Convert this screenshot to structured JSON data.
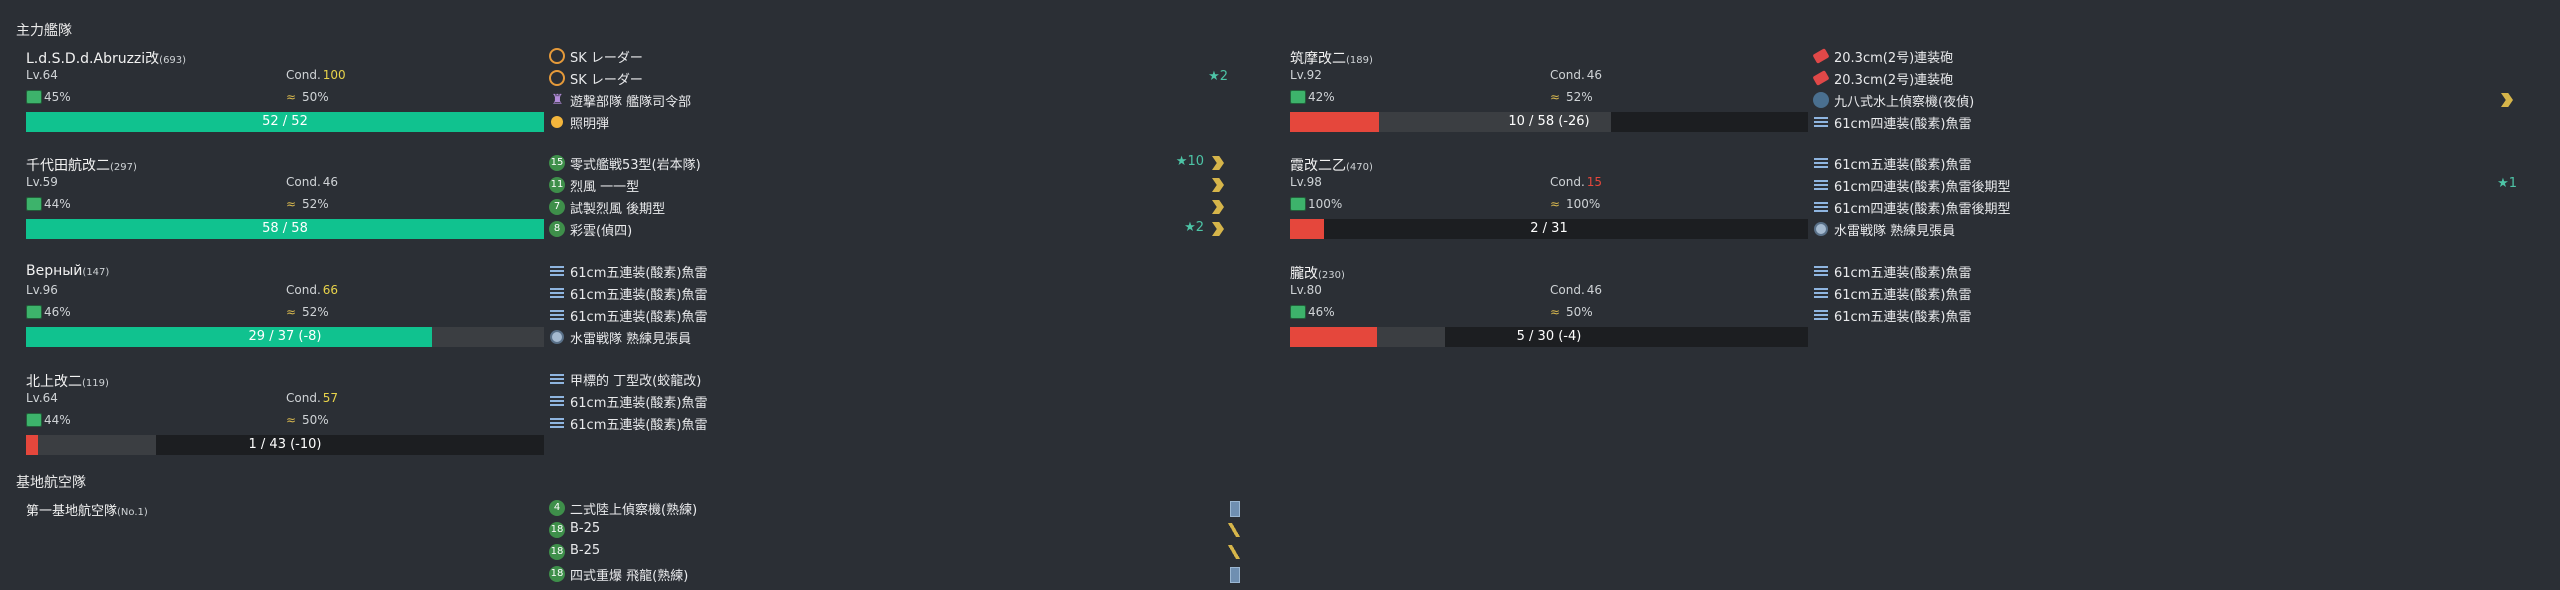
{
  "sections": {
    "fleet": "主力艦隊",
    "airbase": "基地航空隊"
  },
  "ships": [
    {
      "name": "L.d.S.D.d.Abruzzi改",
      "id": "(693)",
      "lv": "Lv.64",
      "cond_label": "Cond.",
      "cond": "100",
      "cond_color": "#e8d34a",
      "fuel": "45%",
      "ammo": "50%",
      "hp": "52 / 52",
      "hp_ratio": 1.0,
      "hp_color": "#10c28f",
      "track_ratio": 1.0,
      "equips": [
        {
          "icon": "radar-icon",
          "name": "SK レーダー",
          "star": "",
          "prof": ""
        },
        {
          "icon": "radar-icon",
          "name": "SK レーダー",
          "star": "★2",
          "prof": ""
        },
        {
          "icon": "command-icon",
          "name": "遊撃部隊 艦隊司令部",
          "star": "",
          "prof": ""
        },
        {
          "icon": "flare-icon",
          "name": "照明弾",
          "star": "",
          "prof": ""
        }
      ]
    },
    {
      "name": "筑摩改二",
      "id": "(189)",
      "lv": "Lv.92",
      "cond_label": "Cond.",
      "cond": "46",
      "cond_color": "#cfd3d6",
      "fuel": "42%",
      "ammo": "52%",
      "hp": "10 / 58 (-26)",
      "hp_ratio": 0.172,
      "hp_color": "#e5473c",
      "track_ratio": 0.62,
      "equips": [
        {
          "icon": "gun-icon",
          "name": "20.3cm(2号)連装砲",
          "star": "",
          "prof": ""
        },
        {
          "icon": "gun-icon",
          "name": "20.3cm(2号)連装砲",
          "star": "",
          "prof": ""
        },
        {
          "icon": "seaplane-icon",
          "name": "九八式水上偵察機(夜偵)",
          "star": "",
          "prof": "chevron"
        },
        {
          "icon": "torpedo-icon",
          "name": "61cm四連装(酸素)魚雷",
          "star": "",
          "prof": ""
        }
      ]
    },
    {
      "name": "千代田航改二",
      "id": "(297)",
      "lv": "Lv.59",
      "cond_label": "Cond.",
      "cond": "46",
      "cond_color": "#cfd3d6",
      "fuel": "44%",
      "ammo": "52%",
      "hp": "58 / 58",
      "hp_ratio": 1.0,
      "hp_color": "#10c28f",
      "track_ratio": 1.0,
      "equips": [
        {
          "icon": "plane-icon",
          "slot": "15",
          "name": "零式艦戦53型(岩本隊)",
          "star": "★10",
          "prof": "chevron"
        },
        {
          "icon": "plane-icon",
          "slot": "11",
          "name": "烈風 一一型",
          "star": "",
          "prof": "chevron"
        },
        {
          "icon": "plane-icon",
          "slot": "7",
          "name": "試製烈風 後期型",
          "star": "",
          "prof": "chevron"
        },
        {
          "icon": "plane-icon",
          "slot": "8",
          "name": "彩雲(偵四)",
          "star": "★2",
          "prof": "chevron"
        }
      ]
    },
    {
      "name": "霞改二乙",
      "id": "(470)",
      "lv": "Lv.98",
      "cond_label": "Cond.",
      "cond": "15",
      "cond_color": "#e5473c",
      "fuel": "100%",
      "ammo": "100%",
      "hp": "2 / 31",
      "hp_ratio": 0.065,
      "hp_color": "#e5473c",
      "track_ratio": 0.065,
      "equips": [
        {
          "icon": "torpedo-icon",
          "name": "61cm五連装(酸素)魚雷",
          "star": "",
          "prof": ""
        },
        {
          "icon": "torpedo-icon",
          "name": "61cm四連装(酸素)魚雷後期型",
          "star": "★1",
          "prof": ""
        },
        {
          "icon": "torpedo-icon",
          "name": "61cm四連装(酸素)魚雷後期型",
          "star": "",
          "prof": ""
        },
        {
          "icon": "sonar-icon",
          "name": "水雷戦隊 熟練見張員",
          "star": "",
          "prof": ""
        }
      ]
    },
    {
      "name": "Верный",
      "id": "(147)",
      "lv": "Lv.96",
      "cond_label": "Cond.",
      "cond": "66",
      "cond_color": "#e8d34a",
      "fuel": "46%",
      "ammo": "52%",
      "hp": "29 / 37 (-8)",
      "hp_ratio": 0.784,
      "hp_color": "#10c28f",
      "track_ratio": 1.0,
      "equips": [
        {
          "icon": "torpedo-icon",
          "name": "61cm五連装(酸素)魚雷",
          "star": "",
          "prof": ""
        },
        {
          "icon": "torpedo-icon",
          "name": "61cm五連装(酸素)魚雷",
          "star": "",
          "prof": ""
        },
        {
          "icon": "torpedo-icon",
          "name": "61cm五連装(酸素)魚雷",
          "star": "",
          "prof": ""
        },
        {
          "icon": "sonar-icon",
          "name": "水雷戦隊 熟練見張員",
          "star": "",
          "prof": ""
        }
      ]
    },
    {
      "name": "朧改",
      "id": "(230)",
      "lv": "Lv.80",
      "cond_label": "Cond.",
      "cond": "46",
      "cond_color": "#cfd3d6",
      "fuel": "46%",
      "ammo": "50%",
      "hp": "5 / 30 (-4)",
      "hp_ratio": 0.167,
      "hp_color": "#e5473c",
      "track_ratio": 0.3,
      "equips": [
        {
          "icon": "torpedo-icon",
          "name": "61cm五連装(酸素)魚雷",
          "star": "",
          "prof": ""
        },
        {
          "icon": "torpedo-icon",
          "name": "61cm五連装(酸素)魚雷",
          "star": "",
          "prof": ""
        },
        {
          "icon": "torpedo-icon",
          "name": "61cm五連装(酸素)魚雷",
          "star": "",
          "prof": ""
        }
      ]
    },
    {
      "name": "北上改二",
      "id": "(119)",
      "lv": "Lv.64",
      "cond_label": "Cond.",
      "cond": "57",
      "cond_color": "#e8d34a",
      "fuel": "44%",
      "ammo": "50%",
      "hp": "1 / 43 (-10)",
      "hp_ratio": 0.023,
      "hp_color": "#e5473c",
      "track_ratio": 0.25,
      "equips": [
        {
          "icon": "submarine-icon",
          "name": "甲標的 丁型改(蛟龍改)",
          "star": "",
          "prof": ""
        },
        {
          "icon": "torpedo-icon",
          "name": "61cm五連装(酸素)魚雷",
          "star": "",
          "prof": ""
        },
        {
          "icon": "torpedo-icon",
          "name": "61cm五連装(酸素)魚雷",
          "star": "",
          "prof": ""
        }
      ]
    }
  ],
  "airbase": {
    "name": "第一基地航空隊",
    "no": "(No.1)",
    "equips": [
      {
        "icon": "plane-icon",
        "slot": "4",
        "name": "二式陸上偵察機(熟練)",
        "prof": "bar"
      },
      {
        "icon": "plane-icon",
        "slot": "18",
        "name": "B-25",
        "prof": "slash"
      },
      {
        "icon": "plane-icon",
        "slot": "18",
        "name": "B-25",
        "prof": "slash"
      },
      {
        "icon": "plane-icon",
        "slot": "18",
        "name": "四式重爆 飛龍(熟練)",
        "prof": "bar"
      }
    ]
  }
}
